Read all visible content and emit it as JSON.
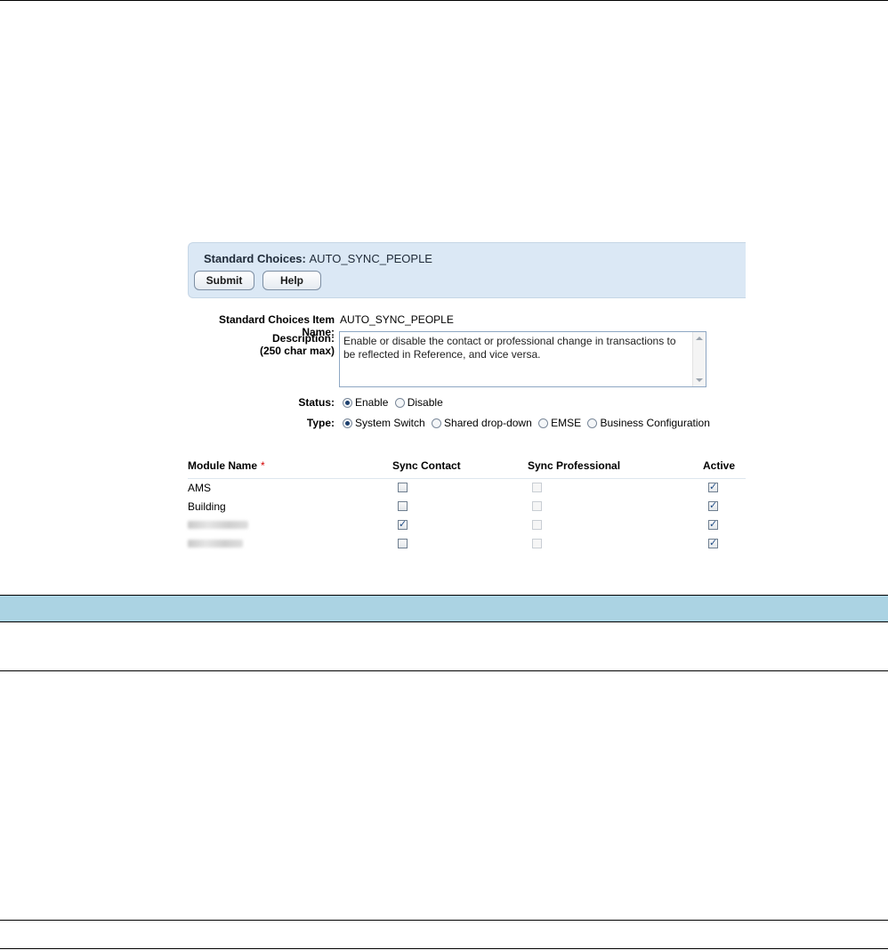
{
  "form": {
    "title_prefix": "Standard Choices:",
    "title_value": "AUTO_SYNC_PEOPLE",
    "buttons": {
      "submit": "Submit",
      "help": "Help"
    },
    "item_name_label": "Standard Choices Item Name:",
    "item_name_value": "AUTO_SYNC_PEOPLE",
    "description_label": "Description:",
    "description_sublabel": "(250 char max)",
    "description_value": "Enable or disable the contact or professional change in transactions to be reflected in Reference, and vice versa.",
    "status_label": "Status:",
    "status_options": [
      "Enable",
      "Disable"
    ],
    "status_selected": "Enable",
    "type_label": "Type:",
    "type_options": [
      "System Switch",
      "Shared drop-down",
      "EMSE",
      "Business Configuration"
    ],
    "type_selected": "System Switch"
  },
  "table": {
    "headers": {
      "module_name": "Module Name",
      "required_mark": "*",
      "sync_contact": "Sync Contact",
      "sync_professional": "Sync Professional",
      "active": "Active"
    },
    "rows": [
      {
        "name": "AMS",
        "sync_contact": false,
        "sync_professional": false,
        "active": true
      },
      {
        "name": "Building",
        "sync_contact": false,
        "sync_professional": false,
        "active": true
      },
      {
        "name": "",
        "sync_contact": true,
        "sync_professional": false,
        "active": true
      },
      {
        "name": "",
        "sync_contact": false,
        "sync_professional": false,
        "active": true
      }
    ]
  },
  "colors": {
    "header_bg": "#dbe8f5",
    "band_bg": "#abd3e3",
    "required": "#d40000"
  }
}
